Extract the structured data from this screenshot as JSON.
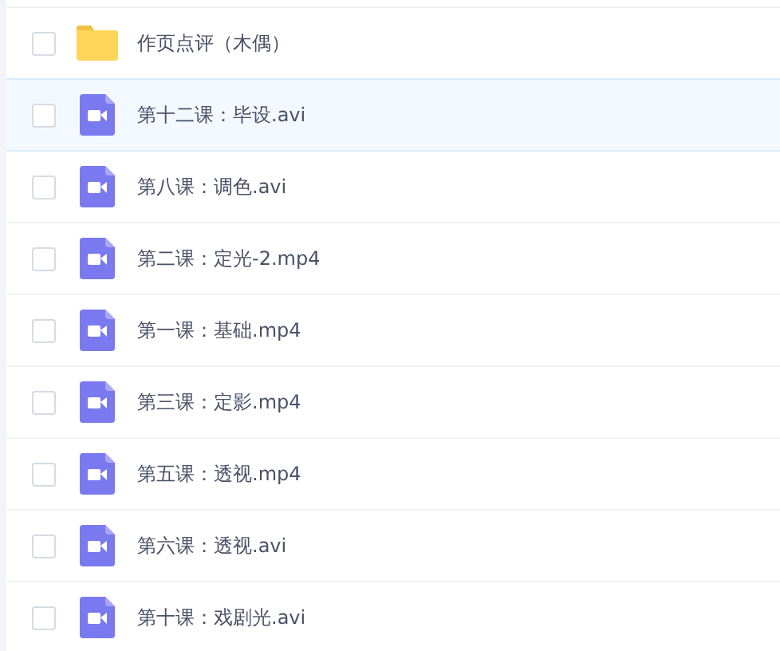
{
  "files": [
    {
      "kind": "folder",
      "name": "作页点评（木偶）",
      "selected": false,
      "checked": false
    },
    {
      "kind": "video",
      "name": "第十二课：毕设.avi",
      "selected": true,
      "checked": false
    },
    {
      "kind": "video",
      "name": "第八课：调色.avi",
      "selected": false,
      "checked": false
    },
    {
      "kind": "video",
      "name": "第二课：定光-2.mp4",
      "selected": false,
      "checked": false
    },
    {
      "kind": "video",
      "name": "第一课：基础.mp4",
      "selected": false,
      "checked": false
    },
    {
      "kind": "video",
      "name": "第三课：定影.mp4",
      "selected": false,
      "checked": false
    },
    {
      "kind": "video",
      "name": "第五课：透视.mp4",
      "selected": false,
      "checked": false
    },
    {
      "kind": "video",
      "name": "第六课：透视.avi",
      "selected": false,
      "checked": false
    },
    {
      "kind": "video",
      "name": "第十课：戏剧光.avi",
      "selected": false,
      "checked": false
    }
  ]
}
